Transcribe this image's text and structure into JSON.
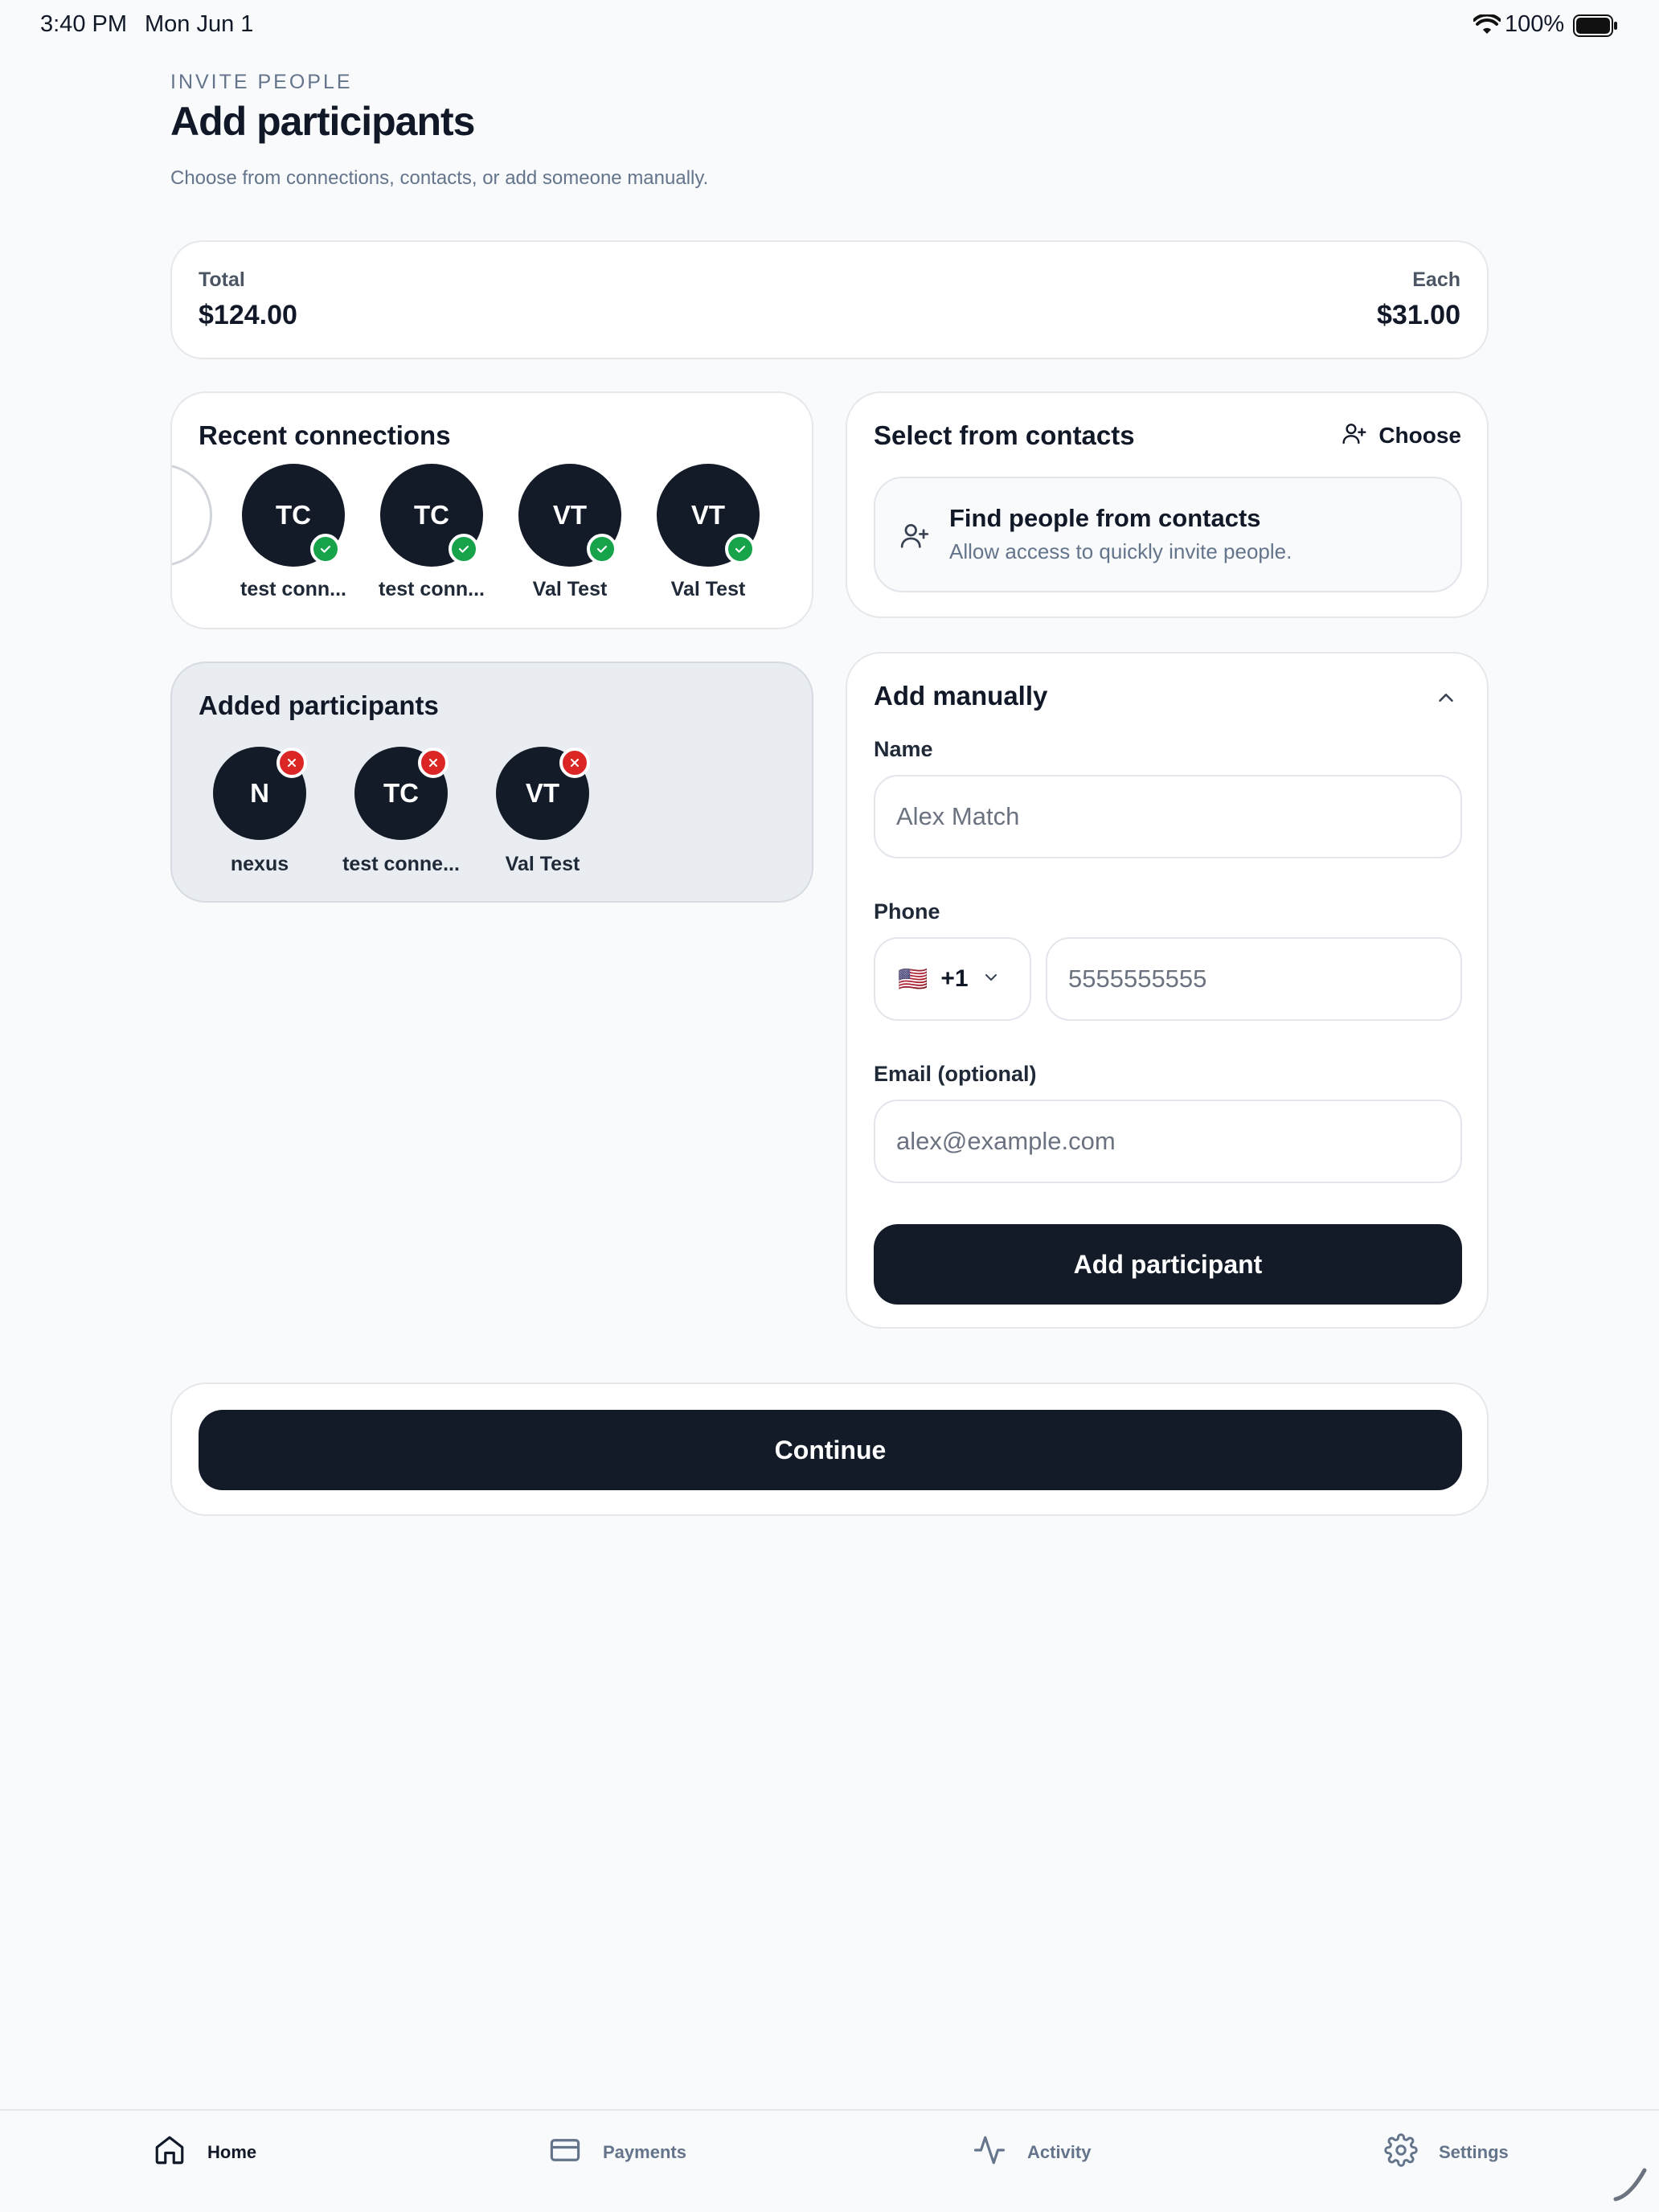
{
  "status_bar": {
    "time": "3:40 PM",
    "date": "Mon Jun 1",
    "battery": "100%"
  },
  "header": {
    "eyebrow": "INVITE PEOPLE",
    "title": "Add participants",
    "subtitle": "Choose from connections, contacts, or add someone manually."
  },
  "summary": {
    "total_label": "Total",
    "total_value": "$124.00",
    "each_label": "Each",
    "each_value": "$31.00"
  },
  "recent_connections": {
    "title": "Recent connections",
    "items": [
      {
        "initials": "TC",
        "name": "test conn..."
      },
      {
        "initials": "TC",
        "name": "test conn..."
      },
      {
        "initials": "VT",
        "name": "Val Test"
      },
      {
        "initials": "VT",
        "name": "Val Test"
      }
    ]
  },
  "contacts": {
    "title": "Select from contacts",
    "choose_label": "Choose",
    "find_title": "Find people from contacts",
    "find_subtitle": "Allow access to quickly invite people."
  },
  "added_participants": {
    "title": "Added participants",
    "items": [
      {
        "initials": "N",
        "name": "nexus"
      },
      {
        "initials": "TC",
        "name": "test conne..."
      },
      {
        "initials": "VT",
        "name": "Val Test"
      }
    ]
  },
  "add_manually": {
    "title": "Add manually",
    "name_label": "Name",
    "name_placeholder": "Alex Match",
    "phone_label": "Phone",
    "country_flag": "🇺🇸",
    "country_code": "+1",
    "phone_placeholder": "5555555555",
    "email_label": "Email (optional)",
    "email_placeholder": "alex@example.com",
    "submit_label": "Add participant"
  },
  "continue_label": "Continue",
  "tab_bar": {
    "tabs": [
      {
        "label": "Home",
        "icon": "home-icon",
        "active": true
      },
      {
        "label": "Payments",
        "icon": "credit-card-icon",
        "active": false
      },
      {
        "label": "Activity",
        "icon": "activity-icon",
        "active": false
      },
      {
        "label": "Settings",
        "icon": "gear-icon",
        "active": false
      }
    ]
  },
  "colors": {
    "primary": "#131a28",
    "success": "#16a34a",
    "danger": "#dc2626",
    "background": "#f8fafc"
  }
}
